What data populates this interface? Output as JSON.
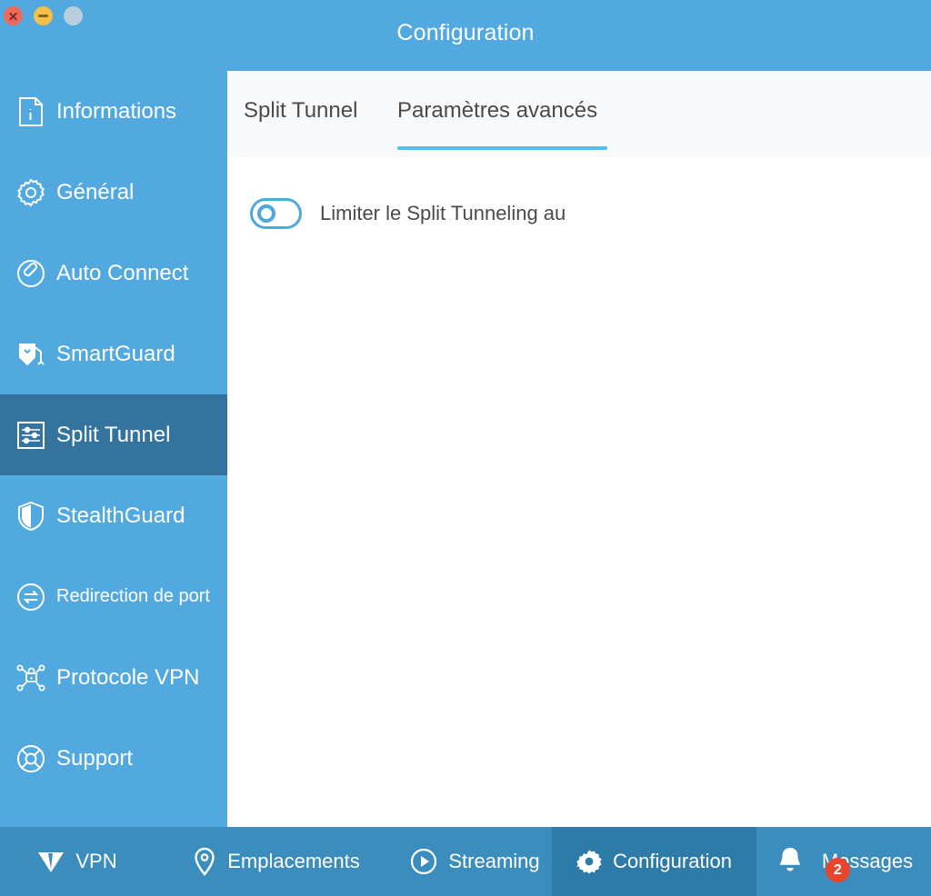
{
  "window": {
    "title": "Configuration",
    "controls": [
      {
        "name": "close",
        "color": "#ef6a5e"
      },
      {
        "name": "minimize",
        "color": "#f3c04a"
      },
      {
        "name": "zoom",
        "color": "#b7cedd"
      }
    ]
  },
  "sidebar": {
    "items": [
      {
        "label": "Informations",
        "icon": "info-document-icon",
        "active": false,
        "small": false
      },
      {
        "label": "Général",
        "icon": "gear-icon",
        "active": false,
        "small": false
      },
      {
        "label": "Auto Connect",
        "icon": "plug-circle-icon",
        "active": false,
        "small": false
      },
      {
        "label": "SmartGuard",
        "icon": "smartguard-icon",
        "active": false,
        "small": false
      },
      {
        "label": "Split Tunnel",
        "icon": "sliders-icon",
        "active": true,
        "small": false
      },
      {
        "label": "StealthGuard",
        "icon": "shield-icon",
        "active": false,
        "small": false
      },
      {
        "label": "Redirection de port",
        "icon": "port-forward-icon",
        "active": false,
        "small": true
      },
      {
        "label": "Protocole VPN",
        "icon": "network-lock-icon",
        "active": false,
        "small": false
      },
      {
        "label": "Support",
        "icon": "lifebuoy-icon",
        "active": false,
        "small": false
      }
    ]
  },
  "content": {
    "tabs": [
      {
        "label": "Split Tunnel",
        "active": false
      },
      {
        "label": "Paramètres avancés",
        "active": true
      }
    ],
    "setting": {
      "label": "Limiter le Split Tunneling au",
      "toggle_state": "off"
    }
  },
  "bottombar": {
    "items": [
      {
        "label": "VPN",
        "icon": "vpn-arrow-icon",
        "active": false,
        "badge": null
      },
      {
        "label": "Emplacements",
        "icon": "map-pin-icon",
        "active": false,
        "badge": null
      },
      {
        "label": "Streaming",
        "icon": "play-icon",
        "active": false,
        "badge": null
      },
      {
        "label": "Configuration",
        "icon": "gear-icon",
        "active": true,
        "badge": null
      },
      {
        "label": "Messages",
        "icon": "bell-icon",
        "active": false,
        "badge": "2"
      }
    ]
  },
  "colors": {
    "sidebar_blue": "#52a9df",
    "sidebar_active": "#33739e",
    "bottom_bar": "#3b8dbe",
    "bottom_active": "#2d7ba8",
    "tab_accent": "#4fc0f5",
    "toggle_blue": "#4fa8dc",
    "badge_red": "#e8452c"
  }
}
